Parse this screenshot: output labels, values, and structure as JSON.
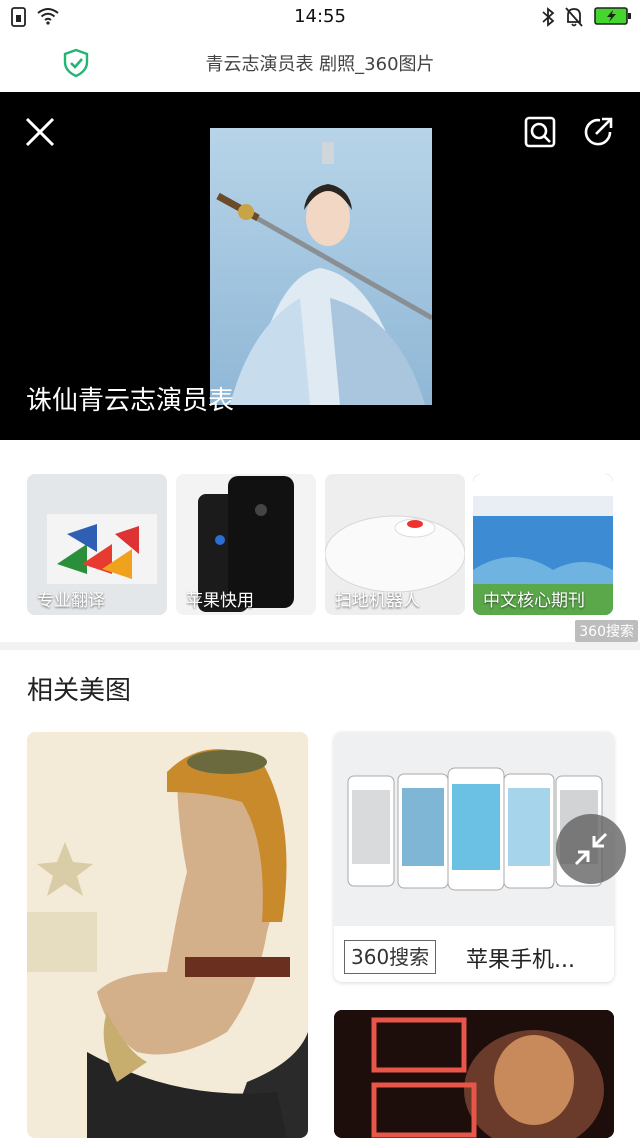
{
  "status_bar": {
    "time": "14:55"
  },
  "header": {
    "title": "青云志演员表 剧照_360图片"
  },
  "viewer": {
    "caption": "诛仙青云志演员表"
  },
  "ads": {
    "items": [
      {
        "label": "专业翻译"
      },
      {
        "label": "苹果快用"
      },
      {
        "label": "扫地机器人"
      },
      {
        "label": "中文核心期刊"
      }
    ],
    "source_badge": "360搜索"
  },
  "related": {
    "title": "相关美图",
    "phone_card": {
      "source": "360搜索",
      "title": "苹果手机..."
    }
  },
  "colors": {
    "accent_green": "#22b573",
    "battery_green": "#44d62c"
  }
}
